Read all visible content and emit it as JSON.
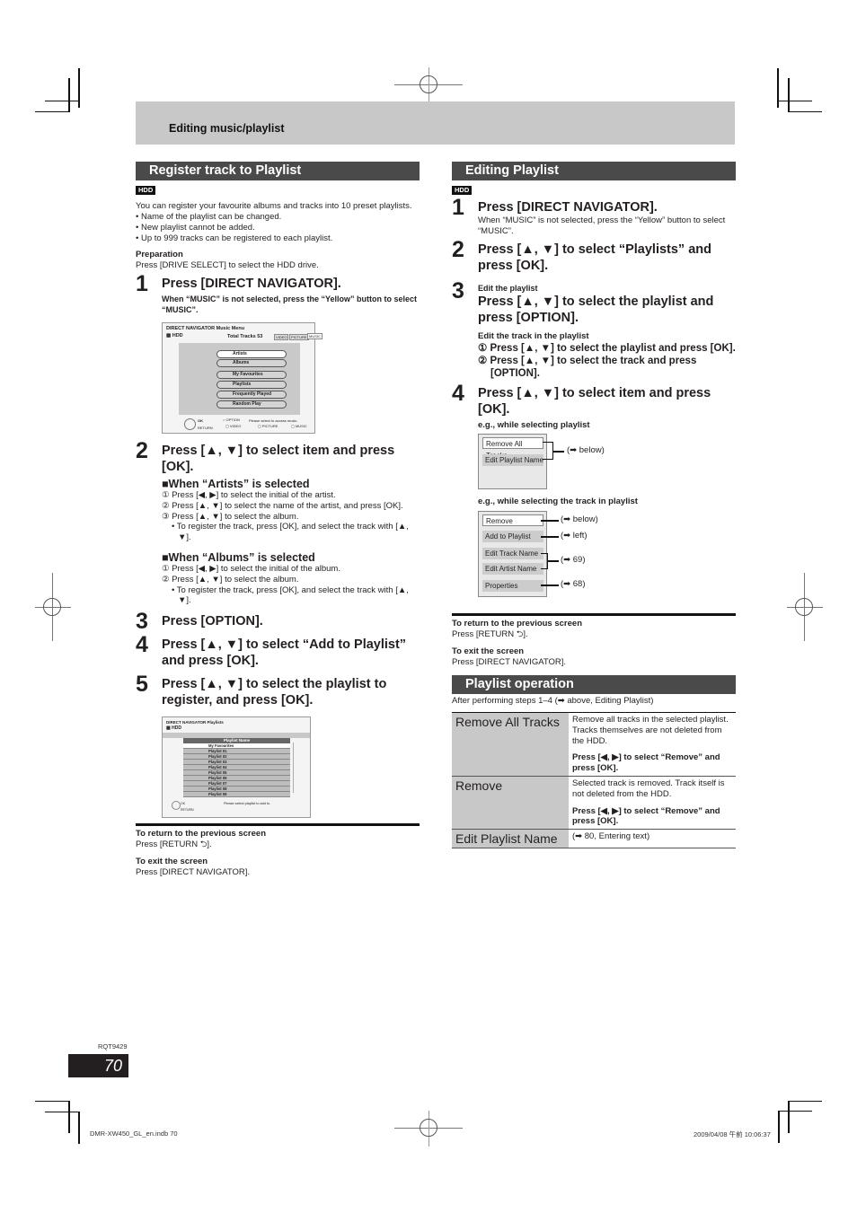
{
  "header": {
    "section_title": "Editing music/playlist"
  },
  "left": {
    "title": "Register track to Playlist",
    "badge": "HDD",
    "intro": "You can register your favourite albums and tracks into 10 preset playlists.",
    "bullets": [
      "• Name of the playlist can be changed.",
      "• New playlist cannot be added.",
      "• Up to 999 tracks can be registered to each playlist."
    ],
    "prep_label": "Preparation",
    "prep_text": "Press [DRIVE SELECT] to select the HDD drive.",
    "steps": [
      {
        "num": "1",
        "head": "Press [DIRECT NAVIGATOR].",
        "sub": "When “MUSIC” is not selected, press the “Yellow” button to select “MUSIC”."
      },
      {
        "num": "2",
        "head": "Press [▲, ▼] to select item and press [OK]."
      },
      {
        "num": "3",
        "head": "Press [OPTION]."
      },
      {
        "num": "4",
        "head": "Press [▲, ▼] to select “Add to Playlist” and press [OK]."
      },
      {
        "num": "5",
        "head": "Press [▲, ▼] to select the playlist to register, and press [OK]."
      }
    ],
    "artists": {
      "head": "■When “Artists” is selected",
      "items": [
        "① Press [◀, ▶] to select the initial of the artist.",
        "② Press [▲, ▼] to select the name of the artist, and press [OK].",
        "③ Press [▲, ▼] to select the album."
      ],
      "note": "• To register the track, press [OK], and select the track with [▲, ▼]."
    },
    "albums": {
      "head": "■When “Albums” is selected",
      "items": [
        "① Press [◀, ▶] to select the initial of the album.",
        "② Press [▲, ▼] to select the album."
      ],
      "note": "• To register the track, press [OK], and select the track with [▲, ▼]."
    },
    "screen1": {
      "title": "DIRECT NAVIGATOR   Music Menu",
      "drive": "HDD",
      "total": "Total Tracks  53",
      "tabs": [
        "VIDEO",
        "PICTURE",
        "MUSIC"
      ],
      "menu": [
        "Artists",
        "Albums",
        "My Favourites",
        "Playlists",
        "Frequently Played",
        "Random Play"
      ],
      "ok": "OK",
      "ret": "RETURN",
      "option": "OPTION",
      "hint": "Please select to access music.",
      "buttons": [
        "VIDEO",
        "PICTURE",
        "MUSIC"
      ]
    },
    "screen2": {
      "title": "DIRECT NAVIGATOR        Playlists",
      "drive": "HDD",
      "header": "Playlist Name",
      "rows": [
        "My Favourites",
        "Playlist 01",
        "Playlist 02",
        "Playlist 03",
        "Playlist 04",
        "Playlist 05",
        "Playlist 06",
        "Playlist 07",
        "Playlist 08",
        "Playlist 09"
      ],
      "ok": "OK",
      "ret": "RETURN",
      "hint": "Please select playlist to add to."
    },
    "return_label": "To return to the previous screen",
    "return_text": "Press [RETURN ⮌].",
    "exit_label": "To exit the screen",
    "exit_text": "Press [DIRECT NAVIGATOR]."
  },
  "right": {
    "title": "Editing Playlist",
    "badge": "HDD",
    "steps": [
      {
        "num": "1",
        "head": "Press [DIRECT NAVIGATOR].",
        "sub": "When “MUSIC” is not selected, press the “Yellow” button to select “MUSIC”."
      },
      {
        "num": "2",
        "head": "Press [▲, ▼] to select “Playlists” and press [OK]."
      },
      {
        "num": "3",
        "label": "Edit the playlist",
        "head": "Press [▲, ▼] to select the playlist and press [OPTION]."
      },
      {
        "num": "4",
        "head": "Press [▲, ▼] to select item and press [OK]."
      }
    ],
    "track_label": "Edit the track in the playlist",
    "track_items": [
      "① Press [▲, ▼] to select the playlist and press [OK].",
      "② Press [▲, ▼] to select the track and press [OPTION]."
    ],
    "eg1_label": "e.g., while selecting playlist",
    "eg1_items": [
      "Remove All Tracks",
      "Edit Playlist Name"
    ],
    "eg1_ref": "(➡ below)",
    "eg2_label": "e.g., while selecting the track in playlist",
    "eg2_items": [
      "Remove",
      "Add to Playlist",
      "Edit Track Name",
      "Edit Artist Name",
      "Properties"
    ],
    "eg2_refs": [
      "(➡ below)",
      "(➡ left)",
      "(➡ 69)",
      "(➡ 68)"
    ],
    "return_label": "To return to the previous screen",
    "return_text": "Press [RETURN ⮌].",
    "exit_label": "To exit the screen",
    "exit_text": "Press [DIRECT NAVIGATOR].",
    "ops_title": "Playlist operation",
    "ops_intro": "After performing steps 1–4 (➡ above, Editing Playlist)",
    "ops": [
      {
        "name": "Remove All Tracks",
        "desc": "Remove all tracks in the selected playlist. Tracks themselves are not deleted from the HDD.",
        "action": "Press [◀, ▶] to select “Remove” and press [OK]."
      },
      {
        "name": "Remove",
        "desc": "Selected track is removed. Track itself is not deleted from the HDD.",
        "action": "Press [◀, ▶] to select “Remove” and press [OK]."
      },
      {
        "name": "Edit Playlist Name",
        "desc": "(➡ 80, Entering text)"
      }
    ]
  },
  "footer": {
    "doc_code": "RQT9429",
    "page_number": "70",
    "file_info": "DMR-XW450_GL_en.indb   70",
    "timestamp": "2009/04/08   午前  10:06:37"
  }
}
